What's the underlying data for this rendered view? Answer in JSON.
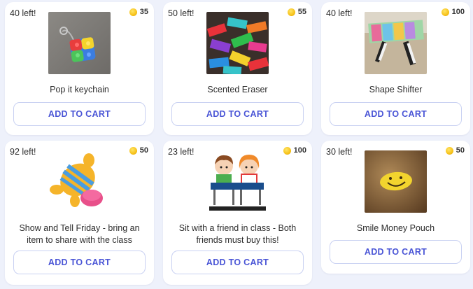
{
  "products": [
    {
      "stock": "40 left!",
      "price": "35",
      "name": "Pop it keychain",
      "button": "ADD TO CART",
      "image": "pop-it-keychain-photo"
    },
    {
      "stock": "50 left!",
      "price": "55",
      "name": "Scented Eraser",
      "button": "ADD TO CART",
      "image": "scented-eraser-photo"
    },
    {
      "stock": "40 left!",
      "price": "100",
      "name": "Shape Shifter",
      "button": "ADD TO CART",
      "image": "shape-shifter-photo"
    },
    {
      "stock": "92 left!",
      "price": "50",
      "name": "Show and Tell Friday - bring an item to share with the class",
      "button": "ADD TO CART",
      "image": "toy-illustration"
    },
    {
      "stock": "23 left!",
      "price": "100",
      "name": "Sit with a friend in class - Both friends must buy this!",
      "button": "ADD TO CART",
      "image": "friends-at-desk-illustration"
    },
    {
      "stock": "30 left!",
      "price": "50",
      "name": "Smile Money Pouch",
      "button": "ADD TO CART",
      "image": "smile-pouch-photo"
    }
  ],
  "colors": {
    "accent": "#4a55d6",
    "background": "#eef1fb",
    "coin": "#f7c21a"
  }
}
